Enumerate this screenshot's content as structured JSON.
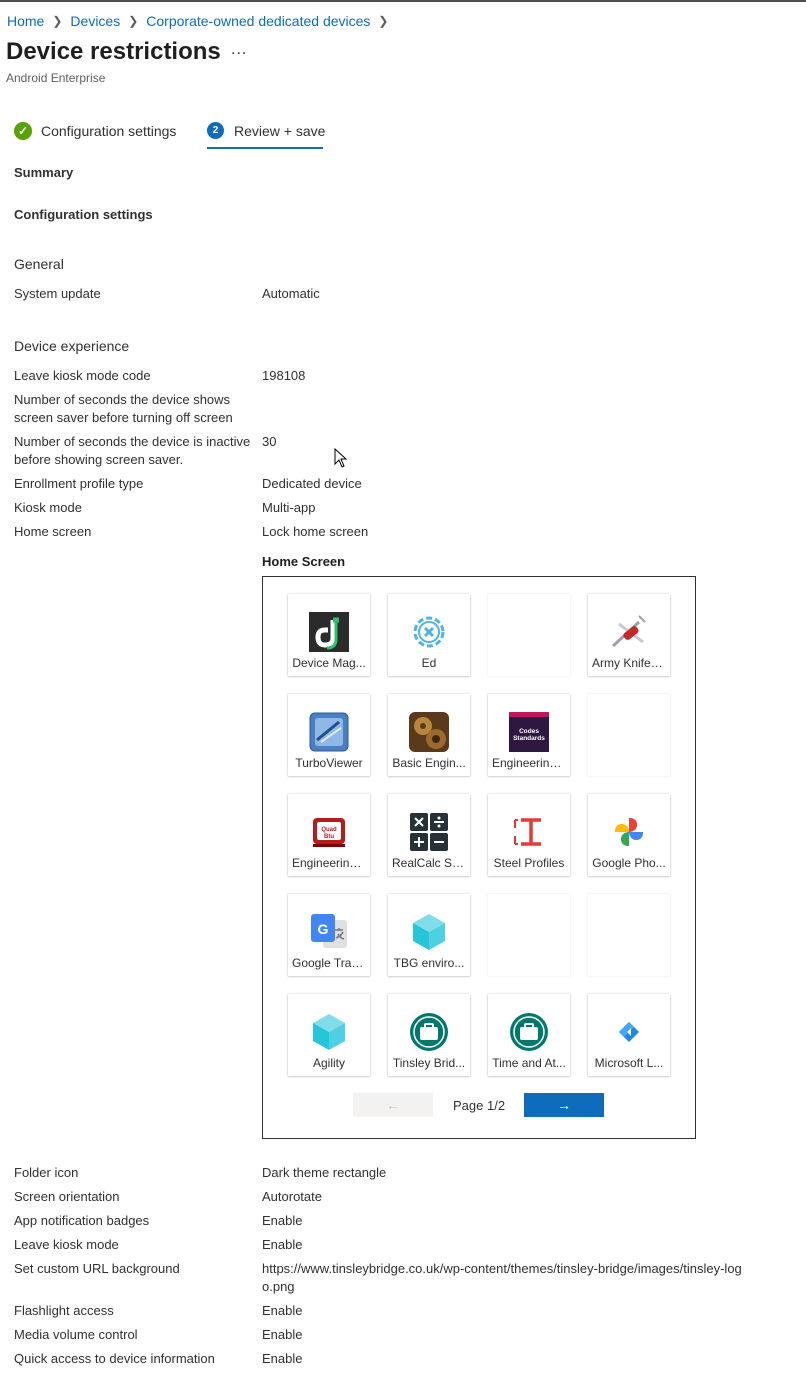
{
  "breadcrumb": [
    "Home",
    "Devices",
    "Corporate-owned dedicated devices"
  ],
  "page": {
    "title": "Device restrictions",
    "more": "...",
    "subtitle": "Android Enterprise"
  },
  "wizard": {
    "step1": "Configuration settings",
    "step2_num": "2",
    "step2": "Review + save"
  },
  "summary": {
    "heading": "Summary",
    "config_heading": "Configuration settings"
  },
  "general": {
    "heading": "General",
    "system_update": {
      "label": "System update",
      "value": "Automatic"
    }
  },
  "device_experience": {
    "heading": "Device experience",
    "rows": [
      {
        "label": "Leave kiosk mode code",
        "value": "198108"
      },
      {
        "label": "Number of seconds the device shows screen saver before turning off screen",
        "value": ""
      },
      {
        "label": "Number of seconds the device is inactive before showing screen saver.",
        "value": "30"
      },
      {
        "label": "Enrollment profile type",
        "value": "Dedicated device"
      },
      {
        "label": "Kiosk mode",
        "value": "Multi-app"
      },
      {
        "label": "Home screen",
        "value": "Lock home screen"
      }
    ]
  },
  "home_screen": {
    "title": "Home Screen",
    "tiles": [
      {
        "name": "Device Mag...",
        "icon": "device-manager-icon"
      },
      {
        "name": "Ed",
        "icon": "ed-gear-icon"
      },
      {
        "name": "",
        "icon": ""
      },
      {
        "name": "Army Knife f...",
        "icon": "army-knife-icon"
      },
      {
        "name": "TurboViewer",
        "icon": "turboviewer-icon"
      },
      {
        "name": "Basic Engin...",
        "icon": "basic-engineering-icon"
      },
      {
        "name": "Engineering...",
        "icon": "codes-standards-icon"
      },
      {
        "name": "",
        "icon": ""
      },
      {
        "name": "Engineering...",
        "icon": "quad-btu-icon"
      },
      {
        "name": "RealCalc Sci...",
        "icon": "realcalc-icon"
      },
      {
        "name": "Steel Profiles",
        "icon": "steel-profiles-icon"
      },
      {
        "name": "Google Pho...",
        "icon": "google-photos-icon"
      },
      {
        "name": "Google Tran...",
        "icon": "google-translate-icon"
      },
      {
        "name": "TBG enviro...",
        "icon": "cube-icon"
      },
      {
        "name": "",
        "icon": ""
      },
      {
        "name": "",
        "icon": ""
      },
      {
        "name": "Agility",
        "icon": "cube-icon"
      },
      {
        "name": "Tinsley Brid...",
        "icon": "briefcase-icon"
      },
      {
        "name": "Time and At...",
        "icon": "briefcase-icon"
      },
      {
        "name": "Microsoft L...",
        "icon": "microsoft-launcher-icon"
      }
    ],
    "codes_text": "Codes Standards",
    "quad_text": "Quad Btu",
    "pager": {
      "prev": "←",
      "label": "Page 1/2",
      "next": "→"
    }
  },
  "more_settings": [
    {
      "label": "Folder icon",
      "value": "Dark theme rectangle"
    },
    {
      "label": "Screen orientation",
      "value": "Autorotate"
    },
    {
      "label": "App notification badges",
      "value": "Enable"
    },
    {
      "label": "Leave kiosk mode",
      "value": "Enable"
    },
    {
      "label": "Set custom URL background",
      "value": "https://www.tinsleybridge.co.uk/wp-content/themes/tinsley-bridge/images/tinsley-logo.png"
    },
    {
      "label": "Flashlight access",
      "value": "Enable"
    },
    {
      "label": "Media volume control",
      "value": "Enable"
    },
    {
      "label": "Quick access to device information",
      "value": "Enable"
    }
  ],
  "colors": {
    "link": "#0f6cbd",
    "success": "#57a300",
    "primary": "#0f6cbd",
    "text": "#323130"
  }
}
